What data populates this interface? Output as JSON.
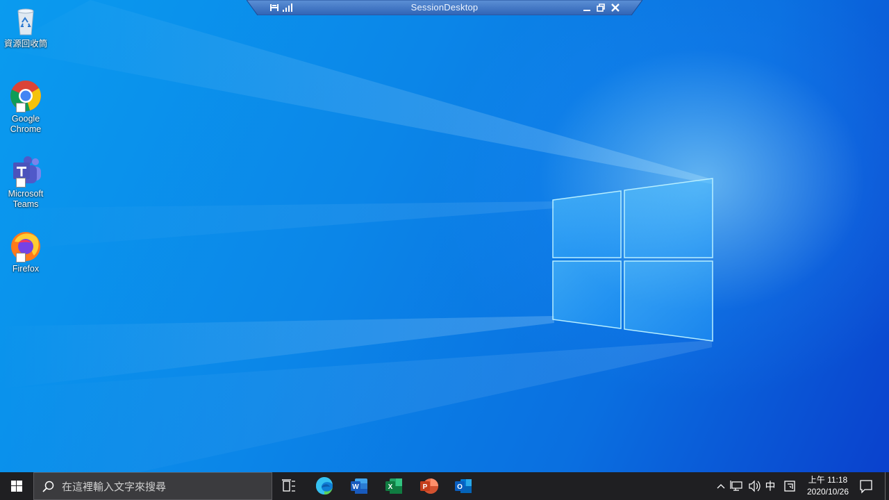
{
  "session_bar": {
    "title": "SessionDesktop",
    "icons": [
      "pin-icon",
      "signal-icon",
      "minimize-icon",
      "restore-icon",
      "close-icon"
    ]
  },
  "desktop_icons": [
    {
      "label": "資源回收筒",
      "icon": "recycle-bin-icon"
    },
    {
      "label": "Google Chrome",
      "icon": "chrome-icon"
    },
    {
      "label": "Microsoft Teams",
      "icon": "teams-icon"
    },
    {
      "label": "Firefox",
      "icon": "firefox-icon"
    }
  ],
  "taskbar": {
    "search_placeholder": "在這裡輸入文字來搜尋",
    "apps": [
      "task-view-icon",
      "edge-icon",
      "word-icon",
      "excel-icon",
      "powerpoint-icon",
      "outlook-icon"
    ],
    "app_letters": {
      "word": "W",
      "excel": "X",
      "powerpoint": "P",
      "outlook": "O"
    },
    "tray": {
      "ime_label": "中",
      "time": "上午 11:18",
      "date": "2020/10/26"
    }
  },
  "colors": {
    "taskbar": "#1f1f22",
    "search_box": "#3b3b3e",
    "wallpaper_left": "#0a9bef",
    "wallpaper_right": "#0a3fcc"
  }
}
